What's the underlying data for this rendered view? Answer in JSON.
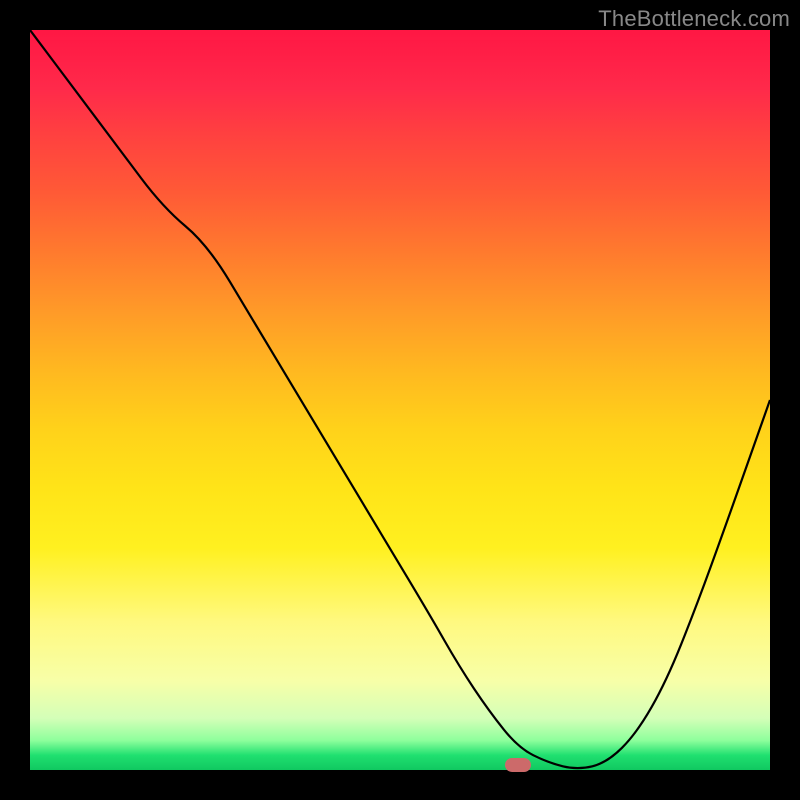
{
  "watermark": "TheBottleneck.com",
  "chart_data": {
    "type": "line",
    "title": "",
    "xlabel": "",
    "ylabel": "",
    "xlim": [
      0,
      100
    ],
    "ylim": [
      0,
      100
    ],
    "x": [
      0,
      6,
      12,
      18,
      24,
      30,
      36,
      42,
      48,
      54,
      58,
      62,
      66,
      70,
      74,
      78,
      82,
      86,
      90,
      94,
      100
    ],
    "values": [
      100,
      92,
      84,
      76,
      71,
      61,
      51,
      41,
      31,
      21,
      14,
      8,
      3,
      1,
      0,
      1,
      5,
      12,
      22,
      33,
      50
    ],
    "marker": {
      "x": 66,
      "y": 0.7
    },
    "background_gradient": {
      "top": "#ff1744",
      "mid_upper": "#ff9a28",
      "mid": "#ffe418",
      "mid_lower": "#f7ffa8",
      "bottom": "#10c860"
    }
  }
}
